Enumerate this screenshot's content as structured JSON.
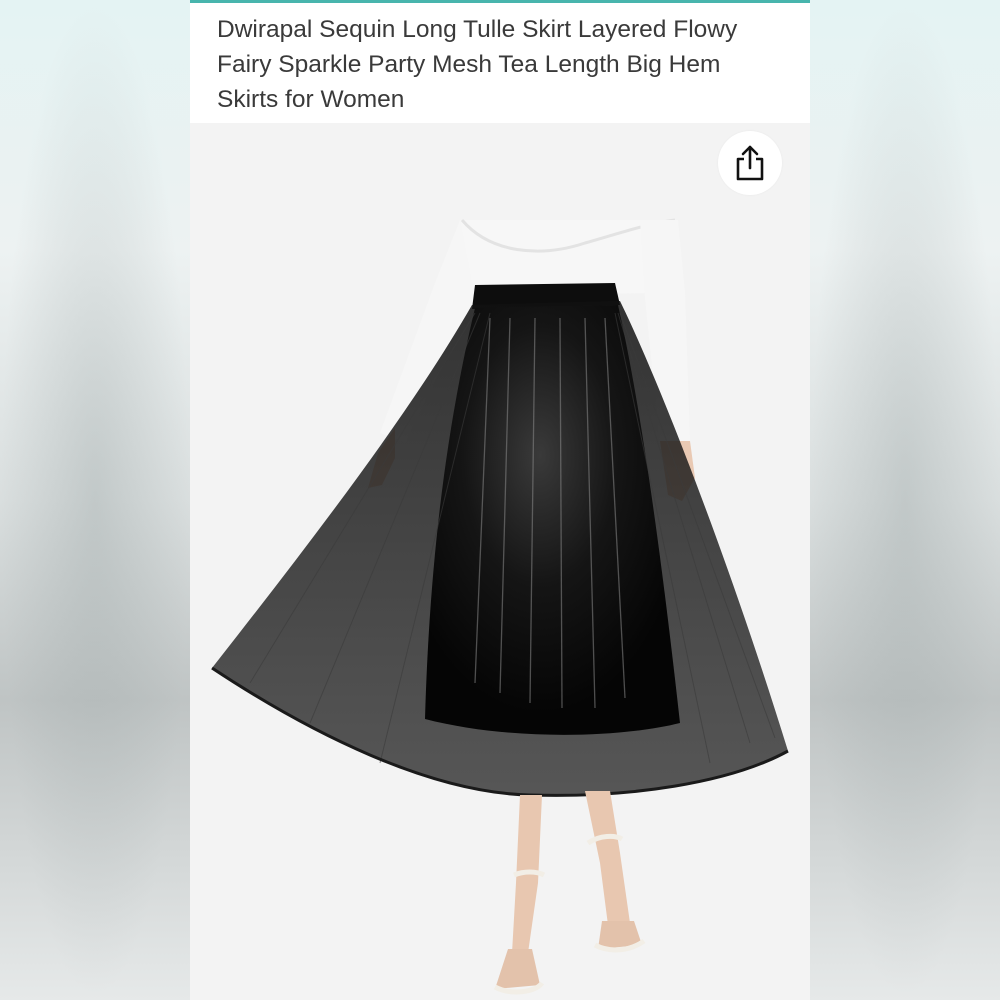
{
  "product": {
    "title": "Dwirapal Sequin Long Tulle Skirt Layered Flowy Fairy Sparkle Party Mesh Tea Length Big Hem Skirts for Women"
  },
  "actions": {
    "share_icon": "share-icon"
  },
  "colors": {
    "accent": "#48b5ad",
    "title_text": "#3a3a3a",
    "skirt": "#0a0a0a"
  }
}
